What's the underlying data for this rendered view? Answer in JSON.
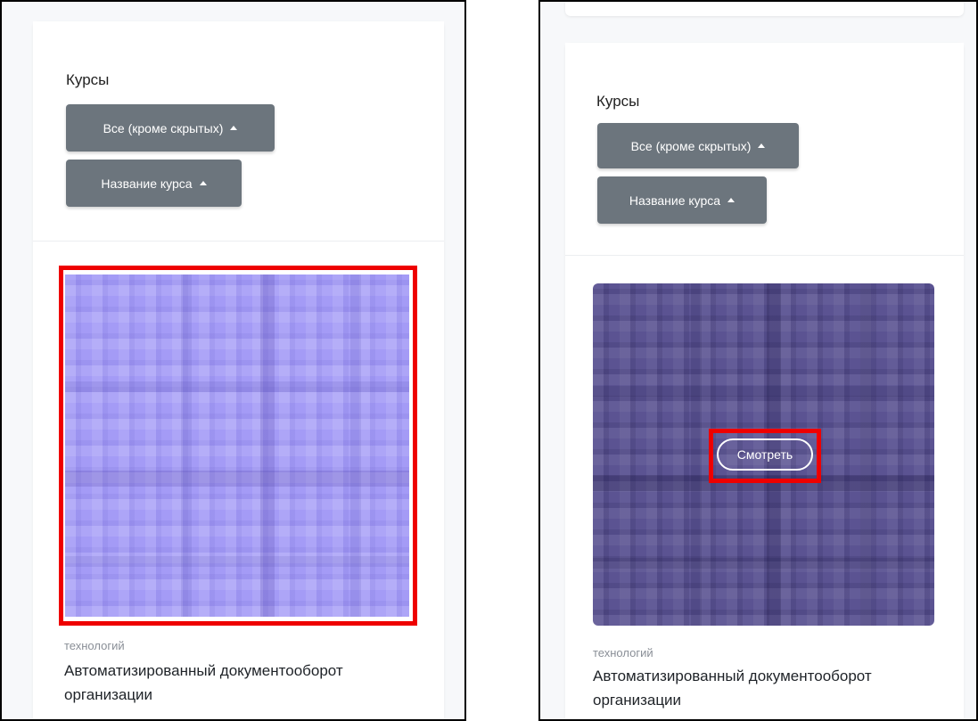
{
  "courses_heading": "Курсы",
  "filter_buttons": {
    "visibility_label": "Все (кроме скрытых)",
    "sort_label": "Название курса"
  },
  "course": {
    "category": "технологий",
    "name_line1": "Автоматизированный документооборот",
    "name_line2": "организации",
    "view_label": "Смотреть"
  },
  "colors": {
    "button_bg": "#6c757d",
    "highlight": "#ee0000",
    "thumb_light": "#a49bf6",
    "thumb_dark": "#5b5392"
  }
}
